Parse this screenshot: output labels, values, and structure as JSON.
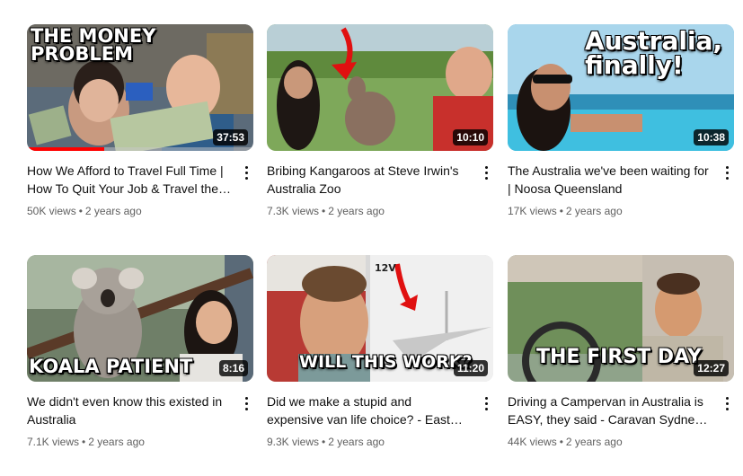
{
  "videos": [
    {
      "overlay": "THE MONEY\nPROBLEM",
      "duration": "37:53",
      "watched_fraction": 0.34,
      "title": "How We Afford to Travel Full Time | How To Quit Your Job & Travel the World",
      "views": "50K views",
      "age": "2 years ago"
    },
    {
      "overlay": "",
      "duration": "10:10",
      "watched_fraction": 0,
      "title": "Bribing Kangaroos at Steve Irwin's Australia Zoo",
      "views": "7.3K views",
      "age": "2 years ago"
    },
    {
      "overlay": "Australia,\nfinally!",
      "duration": "10:38",
      "watched_fraction": 0,
      "title": "The Australia we've been waiting for | Noosa Queensland",
      "views": "17K views",
      "age": "2 years ago"
    },
    {
      "overlay": "KOALA PATIENT",
      "duration": "8:16",
      "watched_fraction": 0,
      "title": "We didn't even know this existed in Australia",
      "views": "7.1K views",
      "age": "2 years ago"
    },
    {
      "overlay": "WILL THIS WORK?",
      "duration": "11:20",
      "watched_fraction": 0,
      "title": "Did we make a stupid and expensive van life choice? - East Coast Road Trip",
      "views": "9.3K views",
      "age": "2 years ago"
    },
    {
      "overlay": "THE FIRST DAY",
      "duration": "12:27",
      "watched_fraction": 0,
      "title": "Driving a Campervan in Australia is EASY, they said - Caravan Sydney to",
      "views": "44K views",
      "age": "2 years ago"
    }
  ],
  "colors": {
    "progress": "#ff0000",
    "meta_text": "#606060",
    "title_text": "#0f0f0f"
  },
  "icons": {
    "more": "more-vert-icon"
  }
}
